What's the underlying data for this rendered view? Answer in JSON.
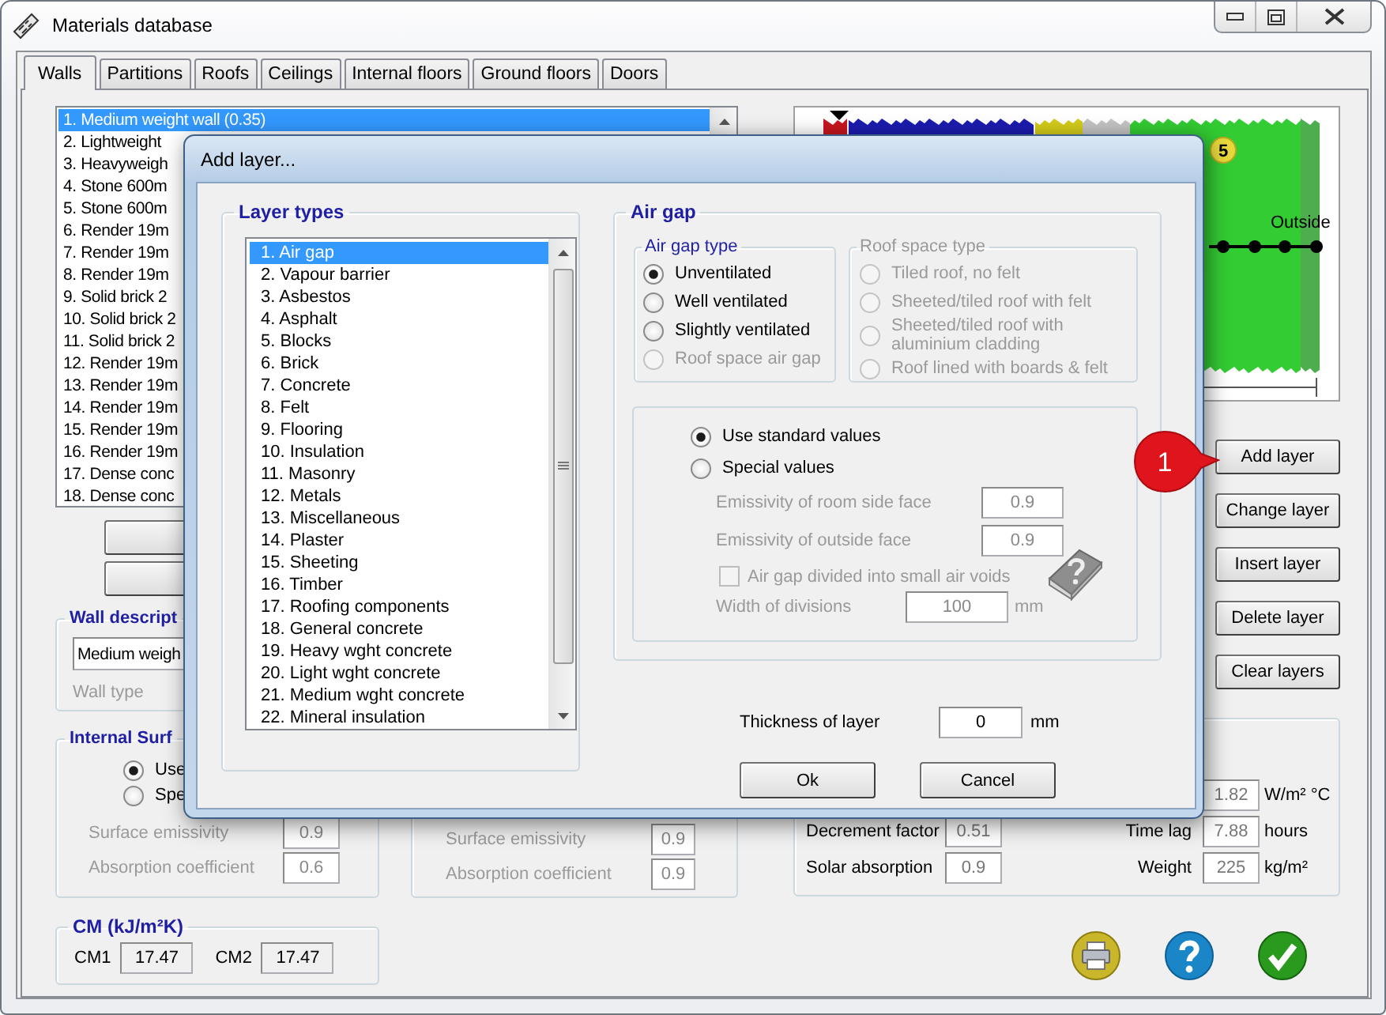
{
  "window": {
    "title": "Materials database"
  },
  "tabs": [
    {
      "label": "Walls",
      "selected": true
    },
    {
      "label": "Partitions",
      "selected": false
    },
    {
      "label": "Roofs",
      "selected": false
    },
    {
      "label": "Ceilings",
      "selected": false
    },
    {
      "label": "Internal floors",
      "selected": false
    },
    {
      "label": "Ground floors",
      "selected": false
    },
    {
      "label": "Doors",
      "selected": false
    }
  ],
  "walls_list": {
    "items": [
      {
        "label": "1. Medium weight wall (0.35)",
        "selected": true
      },
      {
        "label": "2. Lightweight",
        "selected": false
      },
      {
        "label": "3. Heavyweigh",
        "selected": false
      },
      {
        "label": "4. Stone 600m",
        "selected": false
      },
      {
        "label": "5. Stone 600m",
        "selected": false
      },
      {
        "label": "6. Render 19m",
        "selected": false
      },
      {
        "label": "7. Render 19m",
        "selected": false
      },
      {
        "label": "8. Render 19m",
        "selected": false
      },
      {
        "label": "9. Solid brick 2",
        "selected": false
      },
      {
        "label": "10. Solid brick 2",
        "selected": false
      },
      {
        "label": "11. Solid brick 2",
        "selected": false
      },
      {
        "label": "12. Render 19m",
        "selected": false
      },
      {
        "label": "13. Render 19m",
        "selected": false
      },
      {
        "label": "14. Render 19m",
        "selected": false
      },
      {
        "label": "15. Render 19m",
        "selected": false
      },
      {
        "label": "16. Render 19m",
        "selected": false
      },
      {
        "label": "17. Dense conc",
        "selected": false
      },
      {
        "label": "18. Dense conc",
        "selected": false
      }
    ]
  },
  "wall_description": {
    "title": "Wall descript",
    "value": "Medium weigh",
    "type_label": "Wall type"
  },
  "internal_surface": {
    "title": "Internal Surf",
    "options": [
      {
        "label": "Use",
        "selected": true
      },
      {
        "label": "Spe",
        "selected": false
      }
    ],
    "fields": [
      {
        "label": "Surface emissivity",
        "value": "0.9",
        "disabled": true
      },
      {
        "label": "Absorption coefficient",
        "value": "0.6",
        "disabled": true
      }
    ]
  },
  "external_surface": {
    "fields": [
      {
        "label": "Surface emissivity",
        "value": "0.9",
        "disabled": true
      },
      {
        "label": "Absorption coefficient",
        "value": "0.9",
        "disabled": true
      }
    ]
  },
  "cm": {
    "title": "CM (kJ/m²K)",
    "fields": [
      {
        "label": "CM1",
        "value": "17.47"
      },
      {
        "label": "CM2",
        "value": "17.47"
      }
    ]
  },
  "diagram": {
    "side_label": "Outside",
    "badge": "5"
  },
  "layer_buttons": [
    "Add layer",
    "Change layer",
    "Insert layer",
    "Delete layer",
    "Clear layers"
  ],
  "callout": {
    "text": "1"
  },
  "properties": {
    "left": [
      {
        "label": "Decrement factor",
        "value": "0.51"
      },
      {
        "label": "Solar absorption",
        "value": "0.9"
      }
    ],
    "right": [
      {
        "value": "1.82",
        "unit": "W/m² °C"
      },
      {
        "label": "Time lag",
        "value": "7.88",
        "unit": "hours"
      },
      {
        "label": "Weight",
        "value": "225",
        "unit": "kg/m²"
      }
    ]
  },
  "dialog": {
    "title": "Add layer...",
    "layer_types": {
      "title": "Layer types",
      "items": [
        {
          "label": "1. Air gap",
          "selected": true
        },
        {
          "label": "2. Vapour barrier",
          "selected": false
        },
        {
          "label": "3. Asbestos",
          "selected": false
        },
        {
          "label": "4. Asphalt",
          "selected": false
        },
        {
          "label": "5. Blocks",
          "selected": false
        },
        {
          "label": "6. Brick",
          "selected": false
        },
        {
          "label": "7. Concrete",
          "selected": false
        },
        {
          "label": "8. Felt",
          "selected": false
        },
        {
          "label": "9. Flooring",
          "selected": false
        },
        {
          "label": "10. Insulation",
          "selected": false
        },
        {
          "label": "11. Masonry",
          "selected": false
        },
        {
          "label": "12. Metals",
          "selected": false
        },
        {
          "label": "13. Miscellaneous",
          "selected": false
        },
        {
          "label": "14. Plaster",
          "selected": false
        },
        {
          "label": "15. Sheeting",
          "selected": false
        },
        {
          "label": "16. Timber",
          "selected": false
        },
        {
          "label": "17. Roofing components",
          "selected": false
        },
        {
          "label": "18. General concrete",
          "selected": false
        },
        {
          "label": "19. Heavy wght concrete",
          "selected": false
        },
        {
          "label": "20. Light wght concrete",
          "selected": false
        },
        {
          "label": "21. Medium wght concrete",
          "selected": false
        },
        {
          "label": "22. Mineral insulation",
          "selected": false
        }
      ]
    },
    "air_gap": {
      "title": "Air gap",
      "type_group": {
        "title": "Air gap type",
        "options": [
          {
            "label": "Unventilated",
            "selected": true,
            "disabled": false
          },
          {
            "label": "Well ventilated",
            "selected": false,
            "disabled": false
          },
          {
            "label": "Slightly ventilated",
            "selected": false,
            "disabled": false
          },
          {
            "label": "Roof space air gap",
            "selected": false,
            "disabled": true
          }
        ]
      },
      "roof_space": {
        "title": "Roof space type",
        "disabled": true,
        "options": [
          {
            "label": "Tiled roof, no felt",
            "selected": false,
            "disabled": true
          },
          {
            "label": "Sheeted/tiled roof with felt",
            "selected": false,
            "disabled": true
          },
          {
            "label": "Sheeted/tiled roof with aluminium cladding",
            "selected": false,
            "disabled": true
          },
          {
            "label": "Roof lined with boards & felt",
            "selected": false,
            "disabled": true
          }
        ]
      },
      "values": {
        "options": [
          {
            "label": "Use standard values",
            "selected": true
          },
          {
            "label": "Special values",
            "selected": false
          }
        ],
        "fields": [
          {
            "label": "Emissivity of room side face",
            "value": "0.9",
            "disabled": true
          },
          {
            "label": "Emissivity of outside face",
            "value": "0.9",
            "disabled": true
          }
        ],
        "voids": {
          "label": "Air gap divided into small air voids",
          "checked": false,
          "disabled": true
        },
        "divisions": {
          "label": "Width of divisions",
          "value": "100",
          "unit": "mm",
          "disabled": true
        }
      }
    },
    "thickness": {
      "label": "Thickness of layer",
      "value": "0",
      "unit": "mm"
    },
    "buttons": [
      "Ok",
      "Cancel"
    ]
  }
}
